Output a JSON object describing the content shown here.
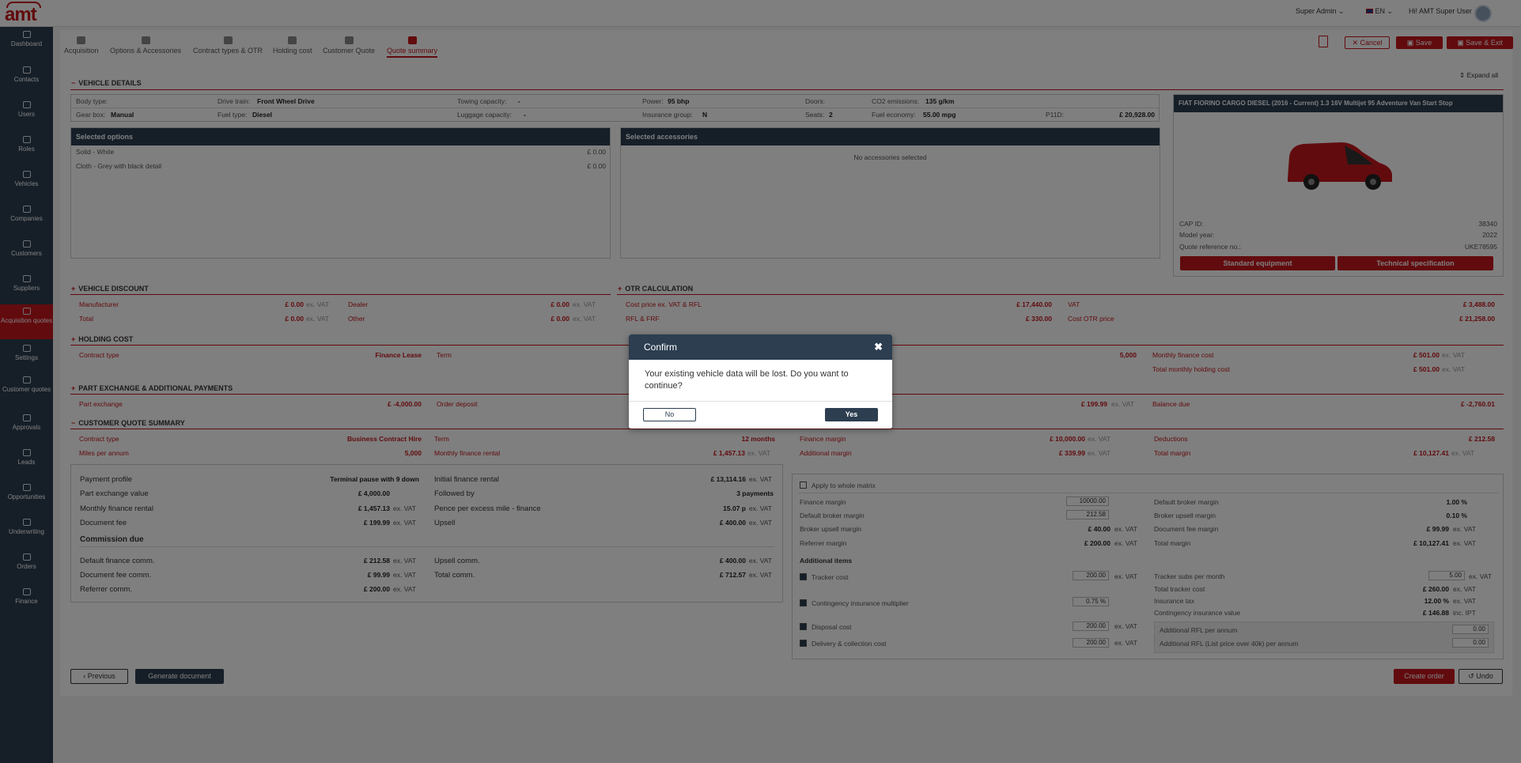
{
  "app": {
    "logo": "amt",
    "role": "Super Admin",
    "lang": "EN",
    "greeting": "Hi! AMT Super User"
  },
  "sidebar": [
    {
      "label": "Dashboard",
      "icon": "dashboard-icon"
    },
    {
      "label": "Contacts",
      "icon": "contacts-icon"
    },
    {
      "label": "Users",
      "icon": "user-icon"
    },
    {
      "label": "Roles",
      "icon": "roles-icon"
    },
    {
      "label": "Vehicles",
      "icon": "car-icon"
    },
    {
      "label": "Companies",
      "icon": "companies-icon"
    },
    {
      "label": "Customers",
      "icon": "customers-icon"
    },
    {
      "label": "Suppliers",
      "icon": "suppliers-icon"
    },
    {
      "label": "Acquisition quotes",
      "icon": "acquisition-icon"
    },
    {
      "label": "Settings",
      "icon": "gear-icon"
    },
    {
      "label": "Customer quotes",
      "icon": "customer-quotes-icon"
    },
    {
      "label": "Approvals",
      "icon": "approvals-icon"
    },
    {
      "label": "Leads",
      "icon": "leads-icon"
    },
    {
      "label": "Opportunities",
      "icon": "opportunities-icon"
    },
    {
      "label": "Underwriting",
      "icon": "underwriting-icon"
    },
    {
      "label": "Orders",
      "icon": "orders-icon"
    },
    {
      "label": "Finance",
      "icon": "pound-icon"
    }
  ],
  "tabs": [
    "Acquisition",
    "Options & Accessories",
    "Contract types & OTR",
    "Holding cost",
    "Customer Quote",
    "Quote summary"
  ],
  "actions": {
    "cancel": "Cancel",
    "save": "Save",
    "save_exit": "Save & Exit",
    "expand_all": "Expand all"
  },
  "vehicle_details": {
    "title": "VEHICLE DETAILS",
    "row1": [
      {
        "label": "Body type:",
        "value": ""
      },
      {
        "label": "Drive train:",
        "value": "Front Wheel Drive"
      },
      {
        "label": "Towing capacity:",
        "value": "-"
      },
      {
        "label": "Power:",
        "value": "95 bhp"
      },
      {
        "label": "Doors:",
        "value": ""
      },
      {
        "label": "CO2 emissions:",
        "value": "135 g/km"
      }
    ],
    "row2": [
      {
        "label": "Gear box:",
        "value": "Manual"
      },
      {
        "label": "Fuel type:",
        "value": "Diesel"
      },
      {
        "label": "Luggage capacity:",
        "value": "-"
      },
      {
        "label": "Insurance group:",
        "value": "N"
      },
      {
        "label": "Seats:",
        "value": "2"
      },
      {
        "label": "Fuel economy:",
        "value": "55.00 mpg"
      },
      {
        "label": "P11D:",
        "value": "£ 20,928.00"
      }
    ]
  },
  "selected_options": {
    "title": "Selected options",
    "items": [
      {
        "name": "Solid - White",
        "price": "£ 0.00"
      },
      {
        "name": "Cloth - Grey with black detail",
        "price": "£ 0.00"
      }
    ]
  },
  "selected_accessories": {
    "title": "Selected accessories",
    "empty": "No accessories selected"
  },
  "vehicle_card": {
    "title": "FIAT FIORINO CARGO DIESEL (2016 - Current) 1.3 16V Multijet 95 Adventure Van Start Stop",
    "cap_label": "CAP ID:",
    "cap": "38340",
    "year_label": "Model year:",
    "year": "2022",
    "ref_label": "Quote reference no.:",
    "ref": "UKE78595",
    "std_btn": "Standard equipment",
    "tech_btn": "Technical specification"
  },
  "vehicle_discount": {
    "title": "VEHICLE DISCOUNT",
    "manufacturer_label": "Manufacturer",
    "manufacturer": "£ 0.00",
    "dealer_label": "Dealer",
    "dealer": "£ 0.00",
    "total_label": "Total",
    "total": "£ 0.00",
    "other_label": "Other",
    "other": "£ 0.00",
    "exvat": "ex. VAT"
  },
  "otr": {
    "title": "OTR CALCULATION",
    "cost_label": "Cost price ex. VAT & RFL",
    "cost": "£ 17,440.00",
    "vat_label": "VAT",
    "vat": "£ 3,488.00",
    "rfl_label": "RFL & FRF",
    "rfl": "£ 330.00",
    "otr_label": "Cost OTR price",
    "otr": "£ 21,258.00"
  },
  "holding": {
    "title": "HOLDING COST",
    "contract_label": "Contract type",
    "contract": "Finance Lease",
    "term_label": "Term",
    "mileage": "5,000",
    "mfc_label": "Monthly finance cost",
    "mfc": "£ 501.00",
    "tmhc_label": "Total monthly holding cost",
    "tmhc": "£ 501.00"
  },
  "part_exchange": {
    "title": "PART EXCHANGE & ADDITIONAL PAYMENTS",
    "px_label": "Part exchange",
    "px": "£ -4,000.00",
    "deposit_label": "Order deposit",
    "deposit_val": "£ 199.99",
    "balance_label": "Balance due",
    "balance": "£ -2,760.01"
  },
  "cqs": {
    "title": "CUSTOMER QUOTE SUMMARY",
    "contract_label": "Contract type",
    "contract": "Business Contract Hire",
    "term_label": "Term",
    "term": "12 months",
    "miles_label": "Miles per annum",
    "miles": "5,000",
    "mfr_label": "Monthly finance rental",
    "mfr": "£ 1,457.13",
    "finance_margin_label": "Finance margin",
    "finance_margin": "£ 10,000.00",
    "deductions_label": "Deductions",
    "deductions": "£ 212.58",
    "add_margin_label": "Additional margin",
    "add_margin": "£ 339.99",
    "total_margin_label": "Total margin",
    "total_margin": "£ 10,127.41"
  },
  "detail_left": [
    {
      "label": "Payment profile",
      "value": "Terminal pause with 9 down",
      "suffix": ""
    },
    {
      "label": "Part exchange value",
      "value": "£ 4,000.00",
      "suffix": ""
    },
    {
      "label": "Monthly finance rental",
      "value": "£ 1,457.13",
      "suffix": "ex. VAT"
    },
    {
      "label": "Document fee",
      "value": "£ 199.99",
      "suffix": "ex. VAT"
    }
  ],
  "detail_right": [
    {
      "label": "Initial finance rental",
      "value": "£ 13,114.16",
      "suffix": "ex. VAT"
    },
    {
      "label": "Followed by",
      "value": "3 payments",
      "suffix": ""
    },
    {
      "label": "Pence per excess mile - finance",
      "value": "15.07 p",
      "suffix": "ex. VAT"
    },
    {
      "label": "Upsell",
      "value": "£ 400.00",
      "suffix": "ex. VAT"
    }
  ],
  "commission": {
    "title": "Commission due",
    "dfc_label": "Default finance comm.",
    "dfc": "£ 212.58",
    "dfee_label": "Document fee comm.",
    "dfee": "£ 99.99",
    "ref_label": "Referrer comm.",
    "ref": "£ 200.00",
    "up_label": "Upsell comm.",
    "up": "£ 400.00",
    "tot_label": "Total comm.",
    "tot": "£ 712.57"
  },
  "matrix": {
    "apply_label": "Apply to whole matrix",
    "fm_label": "Finance margin",
    "fm": "10000.00",
    "dbm_label": "Default broker margin",
    "dbm": "212.58",
    "bum_label": "Broker upsell margin",
    "bum": "£ 40.00",
    "rm_label": "Referrer margin",
    "rm": "£ 200.00",
    "r_dbm_label": "Default broker margin",
    "r_dbm": "1.00 %",
    "r_bum_label": "Broker upsell margin",
    "r_bum": "0.10 %",
    "r_dfm_label": "Document fee margin",
    "r_dfm": "£ 99.99",
    "r_tm_label": "Total margin",
    "r_tm": "£ 10,127.41",
    "add_items": "Additional items",
    "tracker_label": "Tracker cost",
    "tracker": "200.00",
    "cim_label": "Contingency insurance multiplier",
    "cim": "0.75 %",
    "disposal_label": "Disposal cost",
    "disposal": "200.00",
    "delivery_label": "Delivery & collection cost",
    "delivery": "200.00",
    "tspm_label": "Tracker subs per month",
    "tspm": "5.00",
    "ttc_label": "Total tracker cost",
    "ttc": "£ 260.00",
    "it_label": "Insurance tax",
    "it": "12.00 %",
    "civ_label": "Contingency insurance value",
    "civ": "£ 146.88",
    "inc_ipt": "inc. IPT",
    "rfl_label": "Additional RFL per annum",
    "rfl": "0.00",
    "rfl40_label": "Additional RFL (List price over 40k) per annum",
    "rfl40": "0.00"
  },
  "footer": {
    "previous": "Previous",
    "generate": "Generate document",
    "create_order": "Create order",
    "undo": "Undo"
  },
  "modal": {
    "title": "Confirm",
    "message": "Your existing vehicle data will be lost. Do you want to continue?",
    "no": "No",
    "yes": "Yes"
  }
}
